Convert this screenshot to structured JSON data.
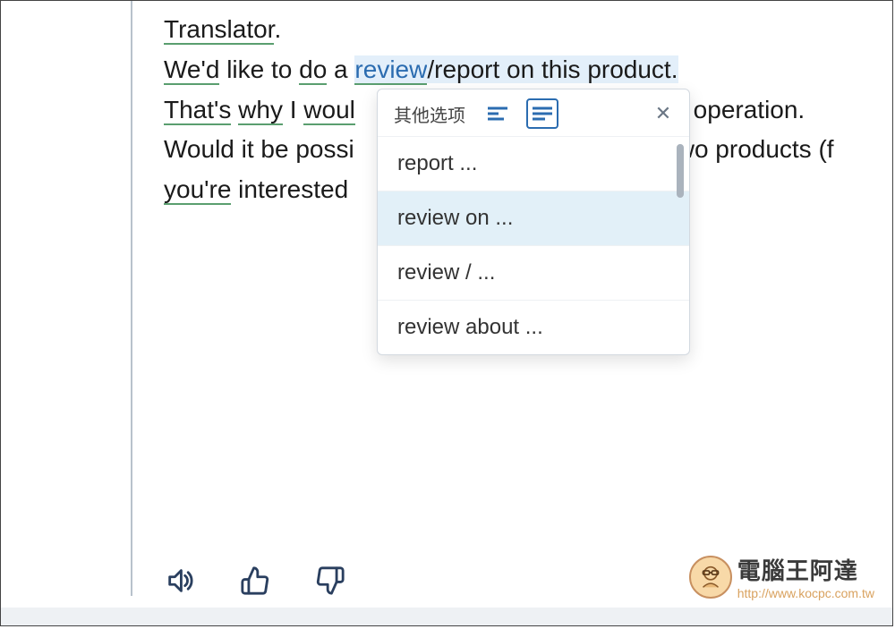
{
  "text": {
    "line1_word1": "Translator",
    "line1_period": ".",
    "line2_w1": "We'd",
    "line2_t1": " like to ",
    "line2_w2": "do",
    "line2_t2": " a ",
    "line2_sel": "review",
    "line2_hl": "/report on this product.",
    "line3_w1": "That's",
    "line3_sp1": " ",
    "line3_w2": "why",
    "line3_t1": " I ",
    "line3_w3": "woul",
    "line3_tail": " operation.",
    "line4_t1": "Would it be possi",
    "line4_t2": "wo products (f",
    "line5_w1": "you're",
    "line5_t1": " interested"
  },
  "popup": {
    "title": "其他选项",
    "items": [
      "report ...",
      "review on ...",
      "review / ...",
      "review about ..."
    ],
    "selected_index": 1
  },
  "icons": {
    "short_lines": "short-lines-icon",
    "long_lines": "long-lines-icon",
    "close": "✕",
    "speaker": "speaker-icon",
    "thumbs_up": "thumbs-up-icon",
    "thumbs_down": "thumbs-down-icon"
  },
  "watermark": {
    "main": "電腦王阿達",
    "sub": "http://www.kocpc.com.tw"
  }
}
